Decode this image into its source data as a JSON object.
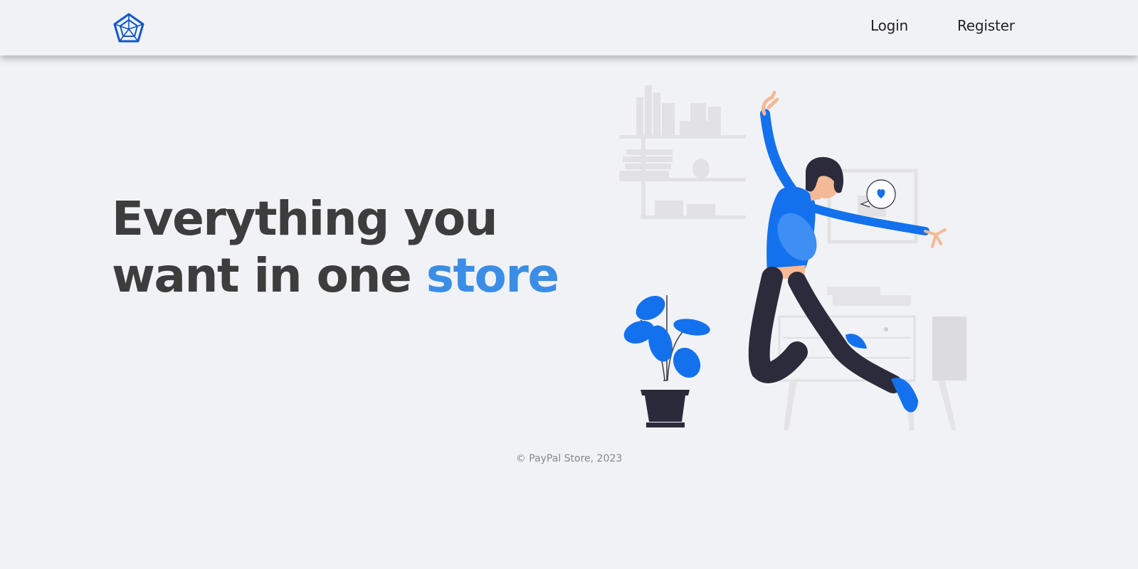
{
  "nav": {
    "logo": "pentagon-web-logo",
    "login_label": "Login",
    "register_label": "Register"
  },
  "hero": {
    "line1": "Everything you",
    "line2_prefix": "want in one ",
    "highlight_word": "store"
  },
  "footer": {
    "text": "© PayPal Store, 2023"
  },
  "colors": {
    "background": "#f1f2f6",
    "heading": "#3d3d3d",
    "accent": "#3a8ee6",
    "illustration_blue": "#1371ee",
    "logo_blue": "#1155cc"
  },
  "illustration": {
    "name": "woman-jumping-illustration"
  }
}
